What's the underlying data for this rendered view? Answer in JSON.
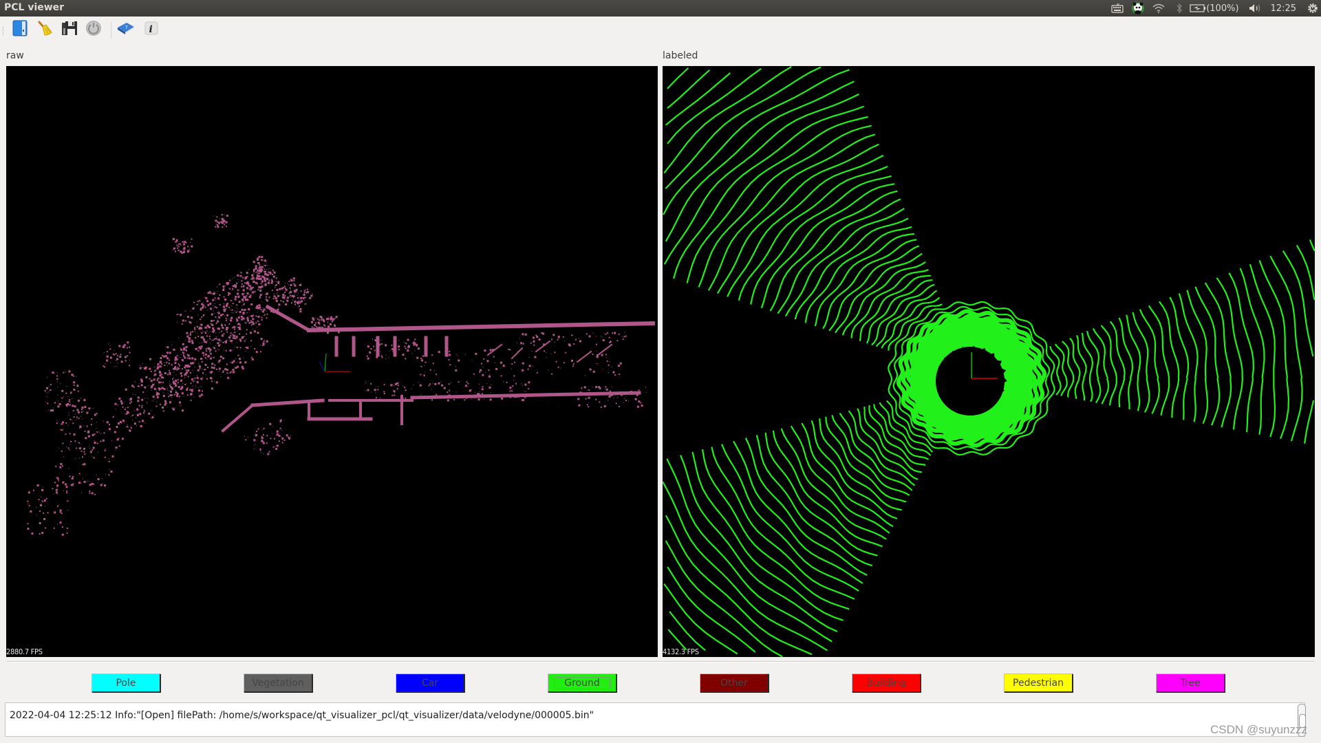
{
  "window": {
    "title": "PCL viewer"
  },
  "tray": {
    "battery": "(100%)",
    "clock": "12:25",
    "icons": [
      "keyboard-icon",
      "panda-app-icon",
      "wifi-icon",
      "bluetooth-icon",
      "battery-icon",
      "volume-icon",
      "power-gear-icon"
    ]
  },
  "toolbar": {
    "buttons": [
      {
        "name": "open-button",
        "icon": "open-file-icon"
      },
      {
        "name": "clear-button",
        "icon": "broom-icon"
      },
      {
        "name": "save-button",
        "icon": "floppy-disk-icon"
      },
      {
        "name": "power-button",
        "icon": "power-icon"
      },
      {
        "name": "help-button",
        "icon": "help-book-icon"
      },
      {
        "name": "about-button",
        "icon": "info-icon"
      }
    ]
  },
  "viewports": {
    "raw": {
      "label": "raw",
      "fps": "2880.7 FPS",
      "point_color": "#b0568a"
    },
    "labeled": {
      "label": "labeled",
      "fps": "4132.3 FPS",
      "point_color": "#22f01a"
    }
  },
  "classes": [
    {
      "label": "Pole",
      "color": "#00ffff"
    },
    {
      "label": "Vegetation",
      "color": "#5f5f5f"
    },
    {
      "label": "Car",
      "color": "#0000ff"
    },
    {
      "label": "Ground",
      "color": "#22ee11"
    },
    {
      "label": "Other",
      "color": "#800000"
    },
    {
      "label": "Building",
      "color": "#ff0000"
    },
    {
      "label": "Pedestrian",
      "color": "#ffff00"
    },
    {
      "label": "Tree",
      "color": "#ff00ff"
    }
  ],
  "log": {
    "lines": [
      "2022-04-04 12:25:12 Info:\"[Open] filePath: /home/s/workspace/qt_visualizer_pcl/qt_visualizer/data/velodyne/000005.bin\""
    ]
  },
  "watermark": "CSDN @suyunzzz"
}
